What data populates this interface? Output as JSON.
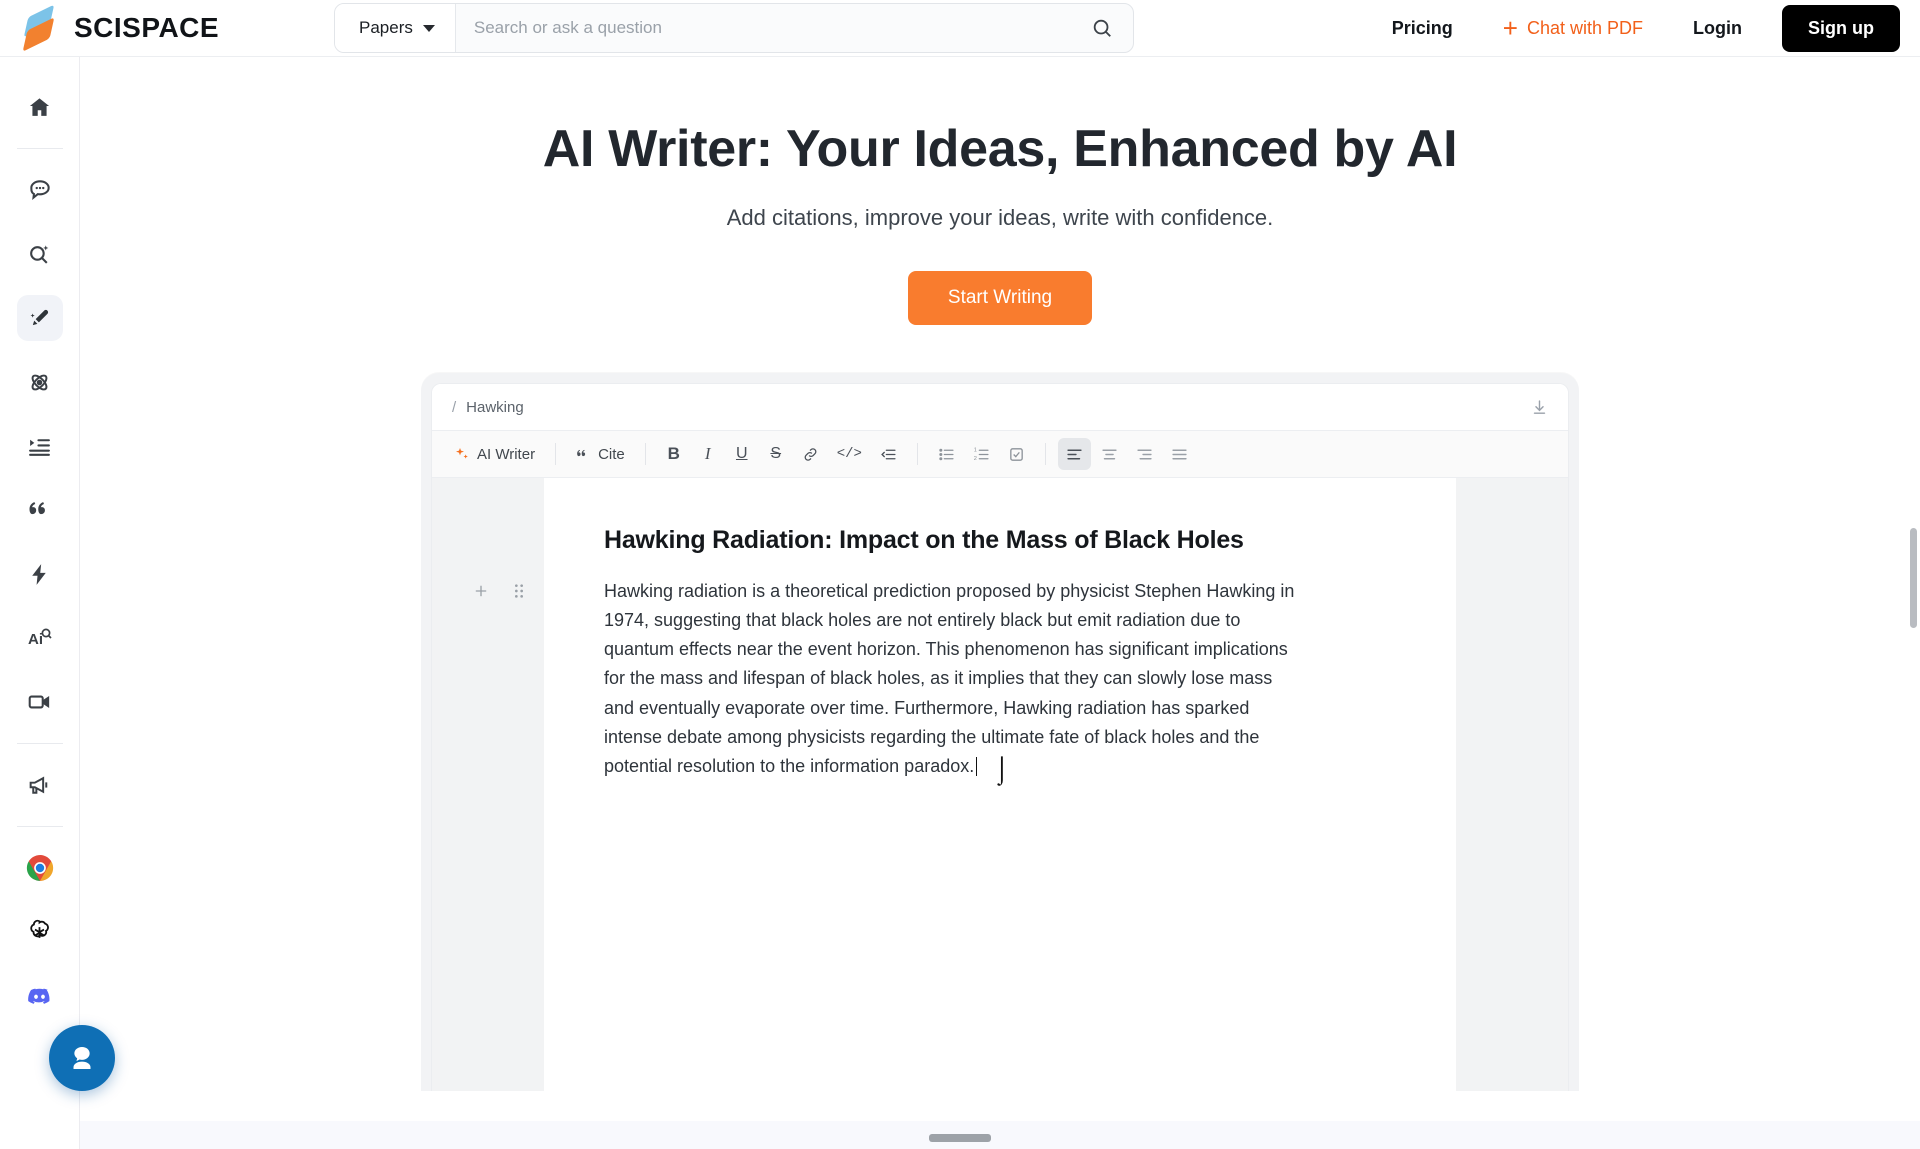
{
  "header": {
    "brand": "SCISPACE",
    "logo_icon": "scispace-logo",
    "search": {
      "scope_label": "Papers",
      "scope_icon": "chevron-down-icon",
      "placeholder": "Search or ask a question",
      "value": "",
      "search_icon": "search-icon"
    },
    "pricing_label": "Pricing",
    "chat_pdf_label": "Chat with PDF",
    "chat_pdf_icon": "plus-icon",
    "login_label": "Login",
    "signup_label": "Sign up",
    "accent_color": "#f2601a",
    "signup_bg": "#000000"
  },
  "sidebar": {
    "items": [
      {
        "icon": "home-icon",
        "name": "home"
      },
      {
        "icon": "chat-bot-icon",
        "name": "chat"
      },
      {
        "icon": "ai-search-icon",
        "name": "ai-search"
      },
      {
        "icon": "ai-writer-pen-icon",
        "name": "ai-writer",
        "active": true
      },
      {
        "icon": "molecule-icon",
        "name": "extract-data"
      },
      {
        "icon": "indent-list-icon",
        "name": "literature-review"
      },
      {
        "icon": "quote-icon",
        "name": "citation-generator"
      },
      {
        "icon": "lightning-icon",
        "name": "paraphraser"
      },
      {
        "icon": "ai-detector-icon",
        "name": "ai-detector"
      },
      {
        "icon": "video-camera-icon",
        "name": "video"
      },
      {
        "icon": "megaphone-icon",
        "name": "announcements"
      },
      {
        "icon": "chrome-logo-icon",
        "name": "chrome-extension"
      },
      {
        "icon": "openai-logo-icon",
        "name": "openai-gpt"
      },
      {
        "icon": "discord-logo-icon",
        "name": "discord"
      }
    ],
    "support_icon": "support-agent-icon",
    "support_color": "#0f6fb5"
  },
  "hero": {
    "title": "AI Writer: Your Ideas, Enhanced by AI",
    "subtitle": "Add citations, improve your ideas, write with confidence.",
    "cta_label": "Start Writing",
    "cta_color": "#f97c2e"
  },
  "editor": {
    "breadcrumb_slash": "/",
    "breadcrumb_label": "Hawking",
    "download_icon": "download-icon",
    "toolbar": {
      "ai_writer_label": "AI Writer",
      "ai_writer_icon": "sparkle-icon",
      "cite_label": "Cite",
      "cite_icon": "quote-icon",
      "bold_label": "B",
      "italic_label": "I",
      "underline_label": "U",
      "strike_label": "S",
      "link_icon": "link-icon",
      "code_icon": "code-icon",
      "outdent_icon": "outdent-icon",
      "bullet_list_icon": "bullet-list-icon",
      "numbered_list_icon": "numbered-list-icon",
      "checklist_icon": "checklist-icon",
      "align_left_icon": "align-left-icon",
      "align_center_icon": "align-center-icon",
      "align_right_icon": "align-right-icon",
      "align_justify_icon": "align-justify-icon",
      "active_align": "align-left"
    },
    "gutter": {
      "add_icon": "plus-icon",
      "drag_icon": "drag-handle-icon"
    },
    "document": {
      "title": "Hawking Radiation: Impact on the Mass of Black Holes",
      "paragraph": "Hawking radiation is a theoretical prediction proposed by physicist Stephen Hawking in 1974, suggesting that black holes are not entirely black but emit radiation due to quantum effects near the event horizon. This phenomenon has significant implications for the mass and lifespan of black holes, as it implies that they can slowly lose mass and eventually evaporate over time. Furthermore, Hawking radiation has sparked intense debate among physicists regarding the ultimate fate of black holes and the potential resolution to the information paradox."
    }
  }
}
